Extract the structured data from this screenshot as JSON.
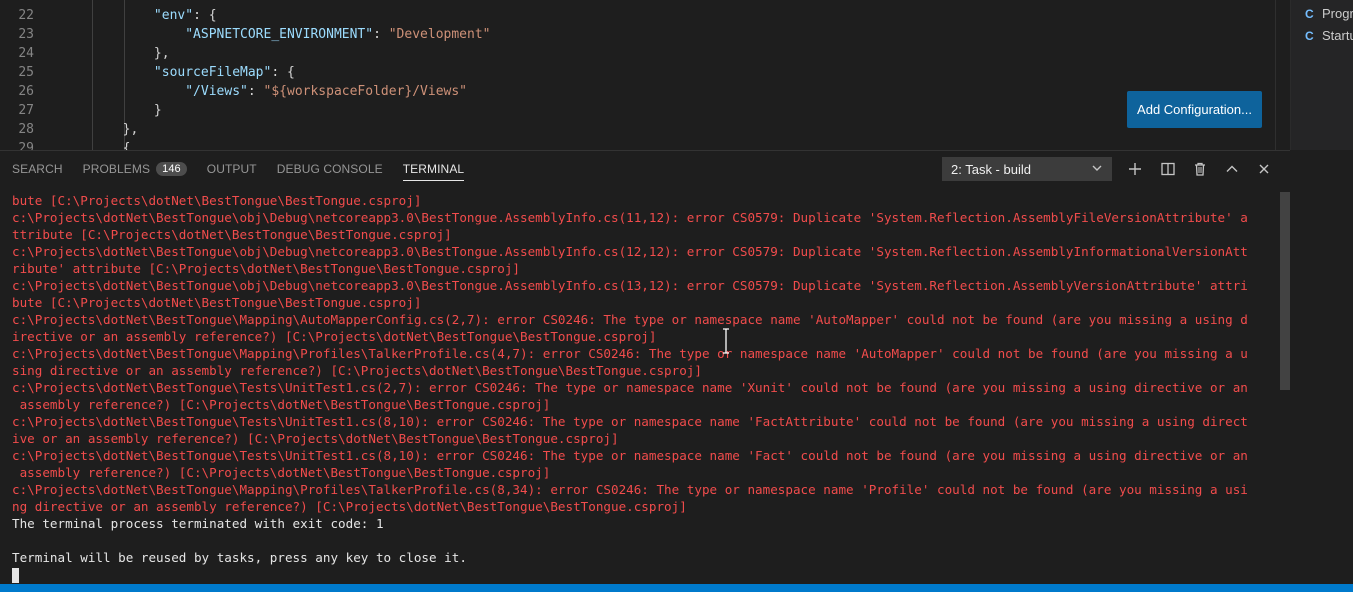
{
  "editor": {
    "line_numbers": [
      "22",
      "23",
      "24",
      "25",
      "26",
      "27",
      "28",
      "29"
    ],
    "lines": [
      {
        "indent": 0,
        "parts": [
          {
            "t": "            ",
            "c": "p"
          },
          {
            "t": "\"env\"",
            "c": "k"
          },
          {
            "t": ": {",
            "c": "p"
          }
        ]
      },
      {
        "indent": 0,
        "parts": [
          {
            "t": "                ",
            "c": "p"
          },
          {
            "t": "\"ASPNETCORE_ENVIRONMENT\"",
            "c": "k"
          },
          {
            "t": ": ",
            "c": "p"
          },
          {
            "t": "\"Development\"",
            "c": "s"
          }
        ]
      },
      {
        "indent": 0,
        "parts": [
          {
            "t": "            },",
            "c": "p"
          }
        ]
      },
      {
        "indent": 0,
        "parts": [
          {
            "t": "            ",
            "c": "p"
          },
          {
            "t": "\"sourceFileMap\"",
            "c": "k"
          },
          {
            "t": ": {",
            "c": "p"
          }
        ]
      },
      {
        "indent": 0,
        "parts": [
          {
            "t": "                ",
            "c": "p"
          },
          {
            "t": "\"/Views\"",
            "c": "k"
          },
          {
            "t": ": ",
            "c": "p"
          },
          {
            "t": "\"${workspaceFolder}/Views\"",
            "c": "s"
          }
        ]
      },
      {
        "indent": 0,
        "parts": [
          {
            "t": "            }",
            "c": "p"
          }
        ]
      },
      {
        "indent": 0,
        "parts": [
          {
            "t": "        },",
            "c": "p"
          }
        ]
      },
      {
        "indent": 0,
        "parts": [
          {
            "t": "        {",
            "c": "p"
          }
        ]
      }
    ],
    "add_configuration_label": "Add Configuration..."
  },
  "outline": {
    "items": [
      {
        "icon": "C",
        "label": "Progr"
      },
      {
        "icon": "C",
        "label": "Startu"
      }
    ]
  },
  "panel": {
    "tabs": {
      "search": "SEARCH",
      "problems": "PROBLEMS",
      "problems_count": "146",
      "output": "OUTPUT",
      "debug_console": "DEBUG CONSOLE",
      "terminal": "TERMINAL"
    },
    "task_select": "2: Task - build"
  },
  "terminal": {
    "lines": [
      {
        "t": "bute [C:\\Projects\\dotNet\\BestTongue\\BestTongue.csproj]",
        "c": "err"
      },
      {
        "t": "c:\\Projects\\dotNet\\BestTongue\\obj\\Debug\\netcoreapp3.0\\BestTongue.AssemblyInfo.cs(11,12): error CS0579: Duplicate 'System.Reflection.AssemblyFileVersionAttribute' a",
        "c": "err"
      },
      {
        "t": "ttribute [C:\\Projects\\dotNet\\BestTongue\\BestTongue.csproj]",
        "c": "err"
      },
      {
        "t": "c:\\Projects\\dotNet\\BestTongue\\obj\\Debug\\netcoreapp3.0\\BestTongue.AssemblyInfo.cs(12,12): error CS0579: Duplicate 'System.Reflection.AssemblyInformationalVersionAtt",
        "c": "err"
      },
      {
        "t": "ribute' attribute [C:\\Projects\\dotNet\\BestTongue\\BestTongue.csproj]",
        "c": "err"
      },
      {
        "t": "c:\\Projects\\dotNet\\BestTongue\\obj\\Debug\\netcoreapp3.0\\BestTongue.AssemblyInfo.cs(13,12): error CS0579: Duplicate 'System.Reflection.AssemblyVersionAttribute' attri",
        "c": "err"
      },
      {
        "t": "bute [C:\\Projects\\dotNet\\BestTongue\\BestTongue.csproj]",
        "c": "err"
      },
      {
        "t": "c:\\Projects\\dotNet\\BestTongue\\Mapping\\AutoMapperConfig.cs(2,7): error CS0246: The type or namespace name 'AutoMapper' could not be found (are you missing a using d",
        "c": "err"
      },
      {
        "t": "irective or an assembly reference?) [C:\\Projects\\dotNet\\BestTongue\\BestTongue.csproj]",
        "c": "err"
      },
      {
        "t": "c:\\Projects\\dotNet\\BestTongue\\Mapping\\Profiles\\TalkerProfile.cs(4,7): error CS0246: The type or namespace name 'AutoMapper' could not be found (are you missing a u",
        "c": "err"
      },
      {
        "t": "sing directive or an assembly reference?) [C:\\Projects\\dotNet\\BestTongue\\BestTongue.csproj]",
        "c": "err"
      },
      {
        "t": "c:\\Projects\\dotNet\\BestTongue\\Tests\\UnitTest1.cs(2,7): error CS0246: The type or namespace name 'Xunit' could not be found (are you missing a using directive or an",
        "c": "err"
      },
      {
        "t": " assembly reference?) [C:\\Projects\\dotNet\\BestTongue\\BestTongue.csproj]",
        "c": "err"
      },
      {
        "t": "c:\\Projects\\dotNet\\BestTongue\\Tests\\UnitTest1.cs(8,10): error CS0246: The type or namespace name 'FactAttribute' could not be found (are you missing a using direct",
        "c": "err"
      },
      {
        "t": "ive or an assembly reference?) [C:\\Projects\\dotNet\\BestTongue\\BestTongue.csproj]",
        "c": "err"
      },
      {
        "t": "c:\\Projects\\dotNet\\BestTongue\\Tests\\UnitTest1.cs(8,10): error CS0246: The type or namespace name 'Fact' could not be found (are you missing a using directive or an",
        "c": "err"
      },
      {
        "t": " assembly reference?) [C:\\Projects\\dotNet\\BestTongue\\BestTongue.csproj]",
        "c": "err"
      },
      {
        "t": "c:\\Projects\\dotNet\\BestTongue\\Mapping\\Profiles\\TalkerProfile.cs(8,34): error CS0246: The type or namespace name 'Profile' could not be found (are you missing a usi",
        "c": "err"
      },
      {
        "t": "ng directive or an assembly reference?) [C:\\Projects\\dotNet\\BestTongue\\BestTongue.csproj]",
        "c": "err"
      },
      {
        "t": "The terminal process terminated with exit code: 1",
        "c": "norm"
      },
      {
        "t": "",
        "c": "norm"
      },
      {
        "t": "Terminal will be reused by tasks, press any key to close it.",
        "c": "norm"
      }
    ]
  },
  "colors": {
    "accent": "#007acc",
    "button": "#0e639c",
    "error": "#f14c4c",
    "json_key": "#9cdcfe",
    "json_string": "#ce9178"
  }
}
